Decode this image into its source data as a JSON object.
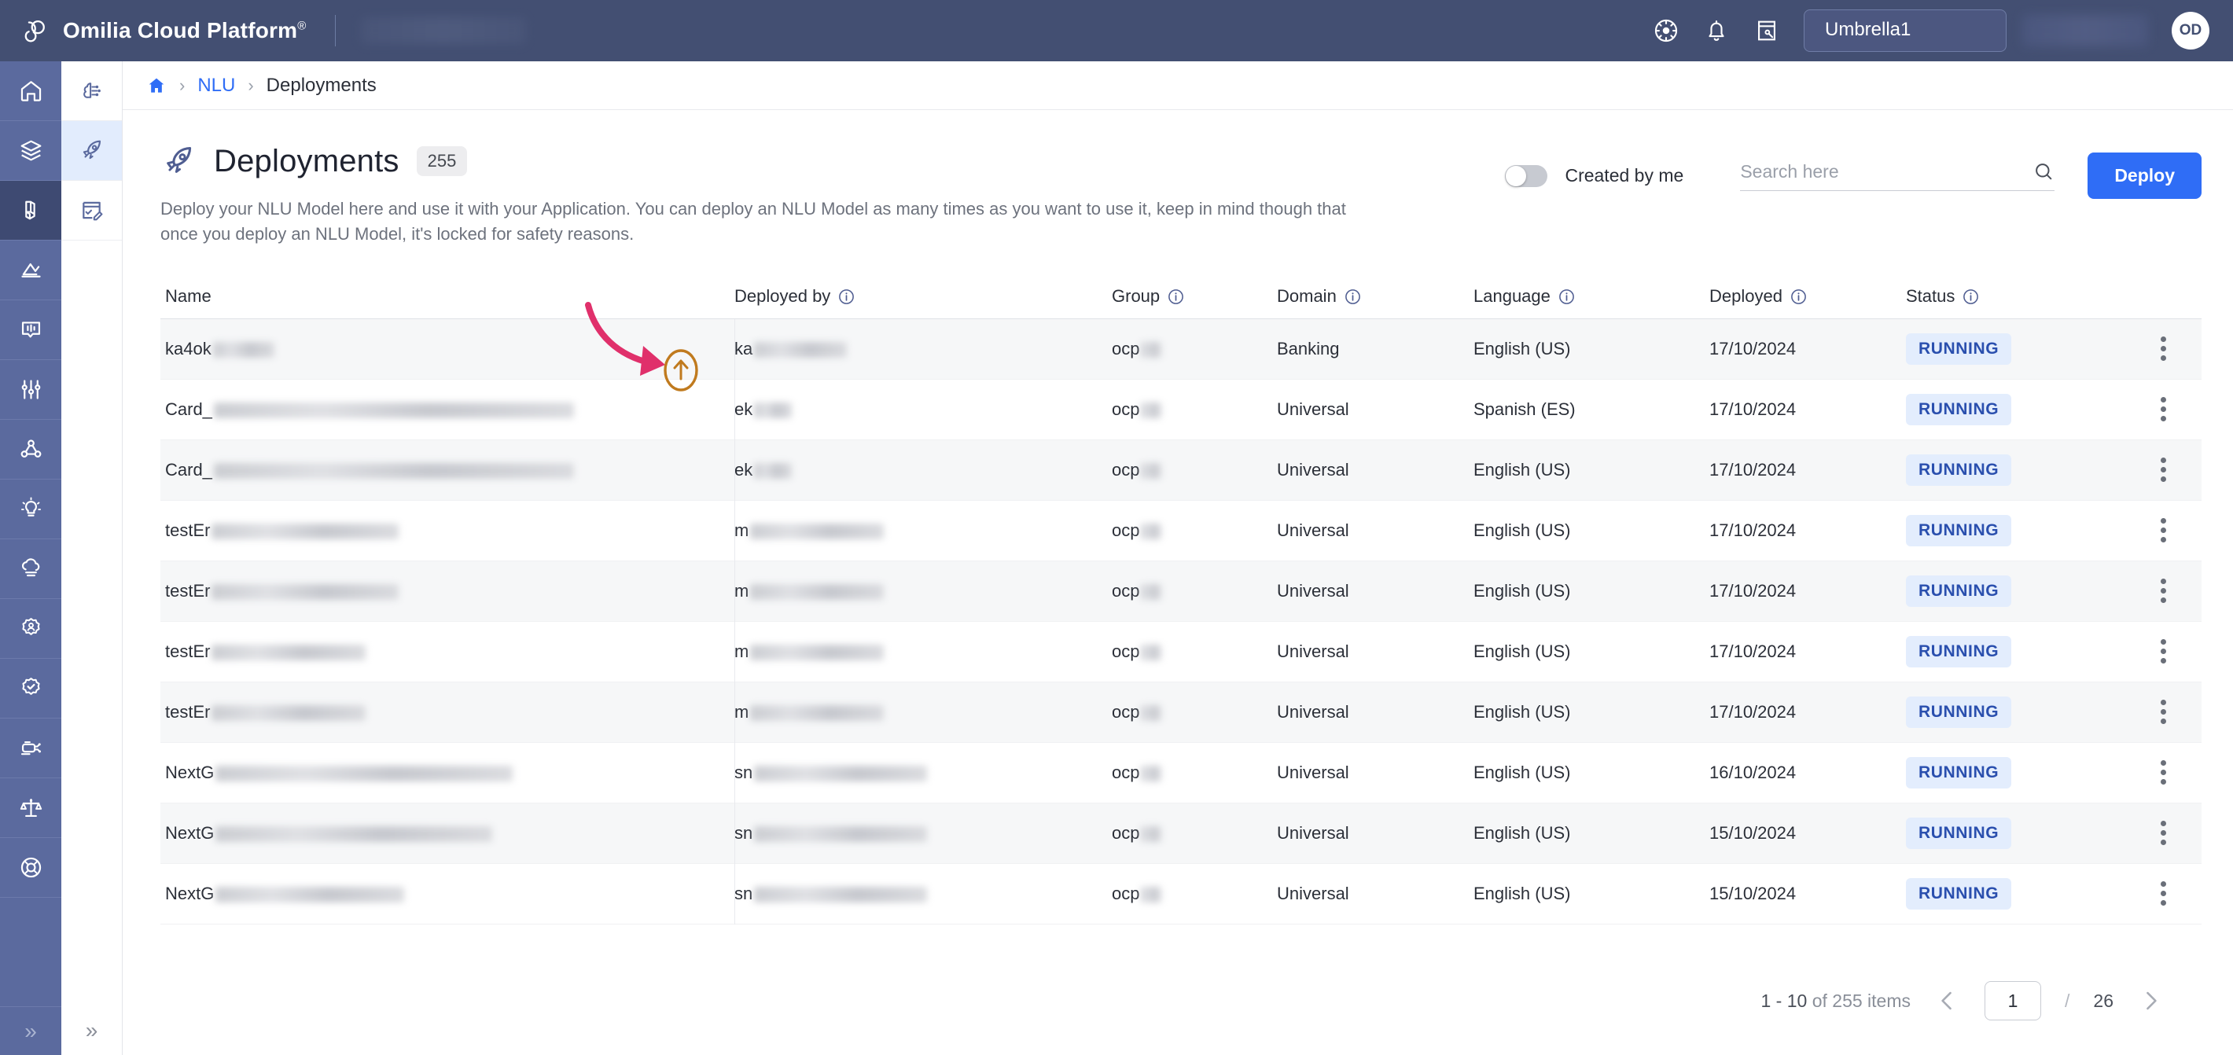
{
  "topbar": {
    "brand_name": "Omilia Cloud Platform",
    "brand_trademark": "®",
    "tenant_chip": "Umbrella1",
    "avatar_initials": "OD",
    "icons": [
      "settings-wheel-icon",
      "bell-icon",
      "notes-pen-icon"
    ]
  },
  "rail": {
    "items": [
      {
        "name": "home",
        "icon": "home-icon"
      },
      {
        "name": "layers",
        "icon": "layers-icon"
      },
      {
        "name": "nlu",
        "icon": "cube-hand-icon",
        "active": true
      },
      {
        "name": "analytics",
        "icon": "chart-line-icon"
      },
      {
        "name": "conversations",
        "icon": "speech-bubble-icon"
      },
      {
        "name": "tuning",
        "icon": "sliders-icon"
      },
      {
        "name": "graph",
        "icon": "nodes-graph-icon"
      },
      {
        "name": "insights",
        "icon": "lightbulb-icon"
      },
      {
        "name": "cloud",
        "icon": "cloud-icon"
      },
      {
        "name": "user-settings",
        "icon": "gear-person-icon"
      },
      {
        "name": "verified",
        "icon": "badge-check-icon"
      },
      {
        "name": "integrations",
        "icon": "circuit-icon"
      },
      {
        "name": "compliance",
        "icon": "scales-icon"
      },
      {
        "name": "support",
        "icon": "lifebuoy-icon"
      }
    ],
    "collapse_glyph": "»"
  },
  "subnav": {
    "items": [
      {
        "name": "models",
        "icon": "brain-ai-icon"
      },
      {
        "name": "deployments",
        "icon": "rocket-icon",
        "active": true
      },
      {
        "name": "annotations",
        "icon": "checklist-pen-icon"
      }
    ],
    "collapse_glyph": "»"
  },
  "breadcrumb": {
    "home_icon": "home-icon",
    "separator": "›",
    "link": "NLU",
    "current": "Deployments"
  },
  "header": {
    "icon": "rocket-icon",
    "title": "Deployments",
    "count": "255",
    "description": "Deploy your NLU Model here and use it with your Application. You can deploy an NLU Model as many times as you want to use it, keep in mind though that once you deploy an NLU Model, it's locked for safety reasons.",
    "toggle_label": "Created by me",
    "toggle_on": false,
    "search_placeholder": "Search here",
    "search_value": "",
    "deploy_label": "Deploy"
  },
  "table": {
    "columns": [
      {
        "key": "name",
        "label": "Name",
        "info": false
      },
      {
        "key": "deployed_by",
        "label": "Deployed by",
        "info": true
      },
      {
        "key": "group",
        "label": "Group",
        "info": true
      },
      {
        "key": "domain",
        "label": "Domain",
        "info": true
      },
      {
        "key": "language",
        "label": "Language",
        "info": true
      },
      {
        "key": "deployed",
        "label": "Deployed",
        "info": true
      },
      {
        "key": "status",
        "label": "Status",
        "info": true
      }
    ],
    "rows": [
      {
        "name": "ka4ok",
        "name_masked": 78,
        "deployed_by": "ka",
        "by_masked": 118,
        "group": "ocp",
        "group_masked": 26,
        "domain": "Banking",
        "language": "English (US)",
        "deployed": "17/10/2024",
        "status": "RUNNING"
      },
      {
        "name": "Card_",
        "name_masked": 458,
        "deployed_by": "ek",
        "by_masked": 48,
        "group": "ocp",
        "group_masked": 26,
        "domain": "Universal",
        "language": "Spanish (ES)",
        "deployed": "17/10/2024",
        "status": "RUNNING"
      },
      {
        "name": "Card_",
        "name_masked": 458,
        "deployed_by": "ek",
        "by_masked": 48,
        "group": "ocp",
        "group_masked": 26,
        "domain": "Universal",
        "language": "English (US)",
        "deployed": "17/10/2024",
        "status": "RUNNING"
      },
      {
        "name": "testEr",
        "name_masked": 238,
        "deployed_by": "m",
        "by_masked": 170,
        "group": "ocp",
        "group_masked": 26,
        "domain": "Universal",
        "language": "English (US)",
        "deployed": "17/10/2024",
        "status": "RUNNING"
      },
      {
        "name": "testEr",
        "name_masked": 238,
        "deployed_by": "m",
        "by_masked": 170,
        "group": "ocp",
        "group_masked": 26,
        "domain": "Universal",
        "language": "English (US)",
        "deployed": "17/10/2024",
        "status": "RUNNING"
      },
      {
        "name": "testEr",
        "name_masked": 196,
        "deployed_by": "m",
        "by_masked": 170,
        "group": "ocp",
        "group_masked": 26,
        "domain": "Universal",
        "language": "English (US)",
        "deployed": "17/10/2024",
        "status": "RUNNING"
      },
      {
        "name": "testEr",
        "name_masked": 196,
        "deployed_by": "m",
        "by_masked": 170,
        "group": "ocp",
        "group_masked": 26,
        "domain": "Universal",
        "language": "English (US)",
        "deployed": "17/10/2024",
        "status": "RUNNING"
      },
      {
        "name": "NextG",
        "name_masked": 378,
        "deployed_by": "sn",
        "by_masked": 220,
        "group": "ocp",
        "group_masked": 26,
        "domain": "Universal",
        "language": "English (US)",
        "deployed": "16/10/2024",
        "status": "RUNNING"
      },
      {
        "name": "NextG",
        "name_masked": 352,
        "deployed_by": "sn",
        "by_masked": 220,
        "group": "ocp",
        "group_masked": 26,
        "domain": "Universal",
        "language": "English (US)",
        "deployed": "15/10/2024",
        "status": "RUNNING"
      },
      {
        "name": "NextG",
        "name_masked": 240,
        "deployed_by": "sn",
        "by_masked": 220,
        "group": "ocp",
        "group_masked": 26,
        "domain": "Universal",
        "language": "English (US)",
        "deployed": "15/10/2024",
        "status": "RUNNING"
      }
    ],
    "row_menu_icon": "kebab-menu-icon"
  },
  "annotation": {
    "arrow_color": "#e0306b",
    "highlight_color": "#c07a1e",
    "target_icon": "upload-circle-icon"
  },
  "footer": {
    "range_label": "1 - 10",
    "of_label": "of 255 items",
    "prev_icon": "chevron-left-icon",
    "next_icon": "chevron-right-icon",
    "page_value": "1",
    "slash": "/",
    "total_pages": "26"
  },
  "colors": {
    "topbar_bg": "#434f72",
    "rail_bg": "#5b6a9e",
    "accent_blue": "#2f6df6",
    "status_badge_bg": "#e3edfd",
    "status_badge_text": "#2a4fae"
  }
}
